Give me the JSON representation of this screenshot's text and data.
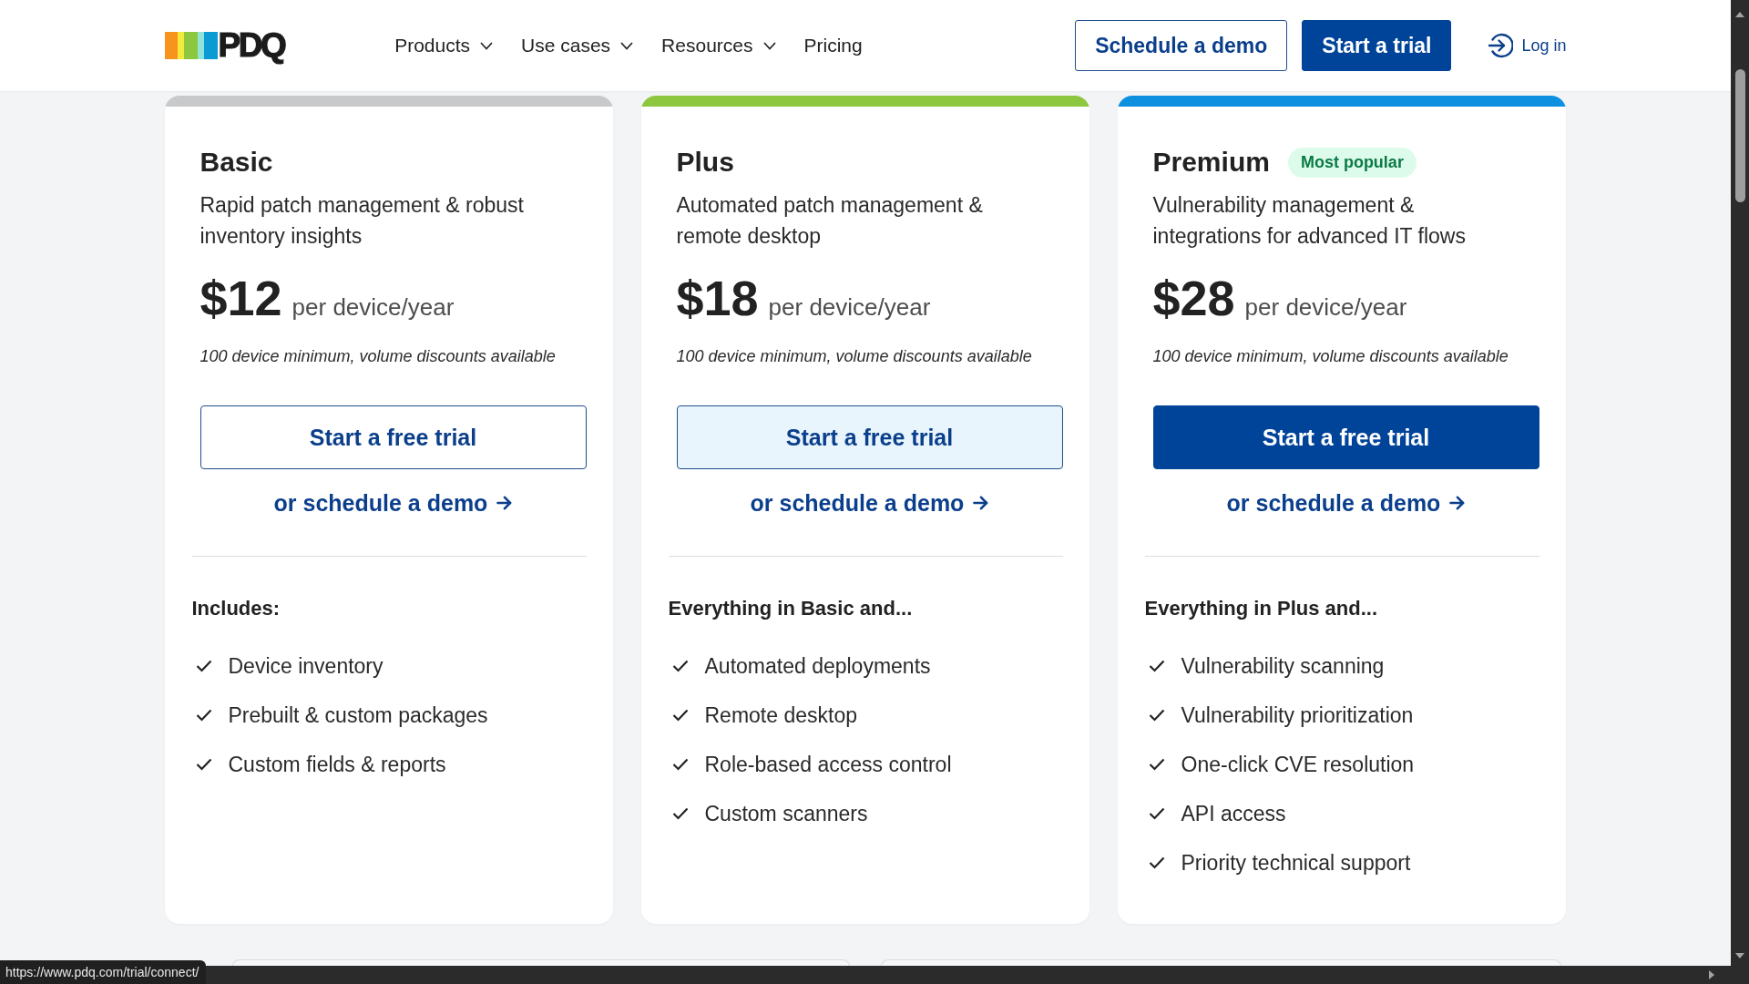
{
  "header": {
    "logo": {
      "text": "PDQ"
    },
    "nav": [
      {
        "label": "Products",
        "dropdown": true
      },
      {
        "label": "Use cases",
        "dropdown": true
      },
      {
        "label": "Resources",
        "dropdown": true
      },
      {
        "label": "Pricing",
        "dropdown": false
      }
    ],
    "buttons": [
      {
        "label": "Schedule a demo",
        "kind": "outline"
      },
      {
        "label": "Start a trial",
        "kind": "solid"
      }
    ],
    "login": {
      "label": "Log in"
    }
  },
  "plans": [
    {
      "name": "Basic",
      "color": "#c8c9cb",
      "description": "Rapid patch management & robust inventory insights",
      "price": "$12",
      "unit": "per device/year",
      "note": "100 device minimum, volume discounts available",
      "trial_button": {
        "label": "Start a free trial",
        "kind": "outline"
      },
      "demo_link": "or schedule a demo",
      "features_heading": "Includes:",
      "features": [
        "Device inventory",
        "Prebuilt & custom packages",
        "Custom fields & reports"
      ]
    },
    {
      "name": "Plus",
      "color": "#8dc63f",
      "description": "Automated patch management & remote desktop",
      "price": "$18",
      "unit": "per device/year",
      "note": "100 device minimum, volume discounts available",
      "trial_button": {
        "label": "Start a free trial",
        "kind": "tinted"
      },
      "demo_link": "or schedule a demo",
      "features_heading": "Everything in Basic and...",
      "features": [
        "Automated deployments",
        "Remote desktop",
        "Role-based access control",
        "Custom scanners"
      ]
    },
    {
      "name": "Premium",
      "color": "#0e90e0",
      "badge": "Most popular",
      "description": "Vulnerability management & integrations for advanced IT flows",
      "price": "$28",
      "unit": "per device/year",
      "note": "100 device minimum, volume discounts available",
      "trial_button": {
        "label": "Start a free trial",
        "kind": "solid"
      },
      "demo_link": "or schedule a demo",
      "features_heading": "Everything in Plus and...",
      "features": [
        "Vulnerability scanning",
        "Vulnerability prioritization",
        "One-click CVE resolution",
        "API access",
        "Priority technical support"
      ]
    }
  ],
  "status_bar": {
    "url": "https://www.pdq.com/trial/connect/"
  }
}
